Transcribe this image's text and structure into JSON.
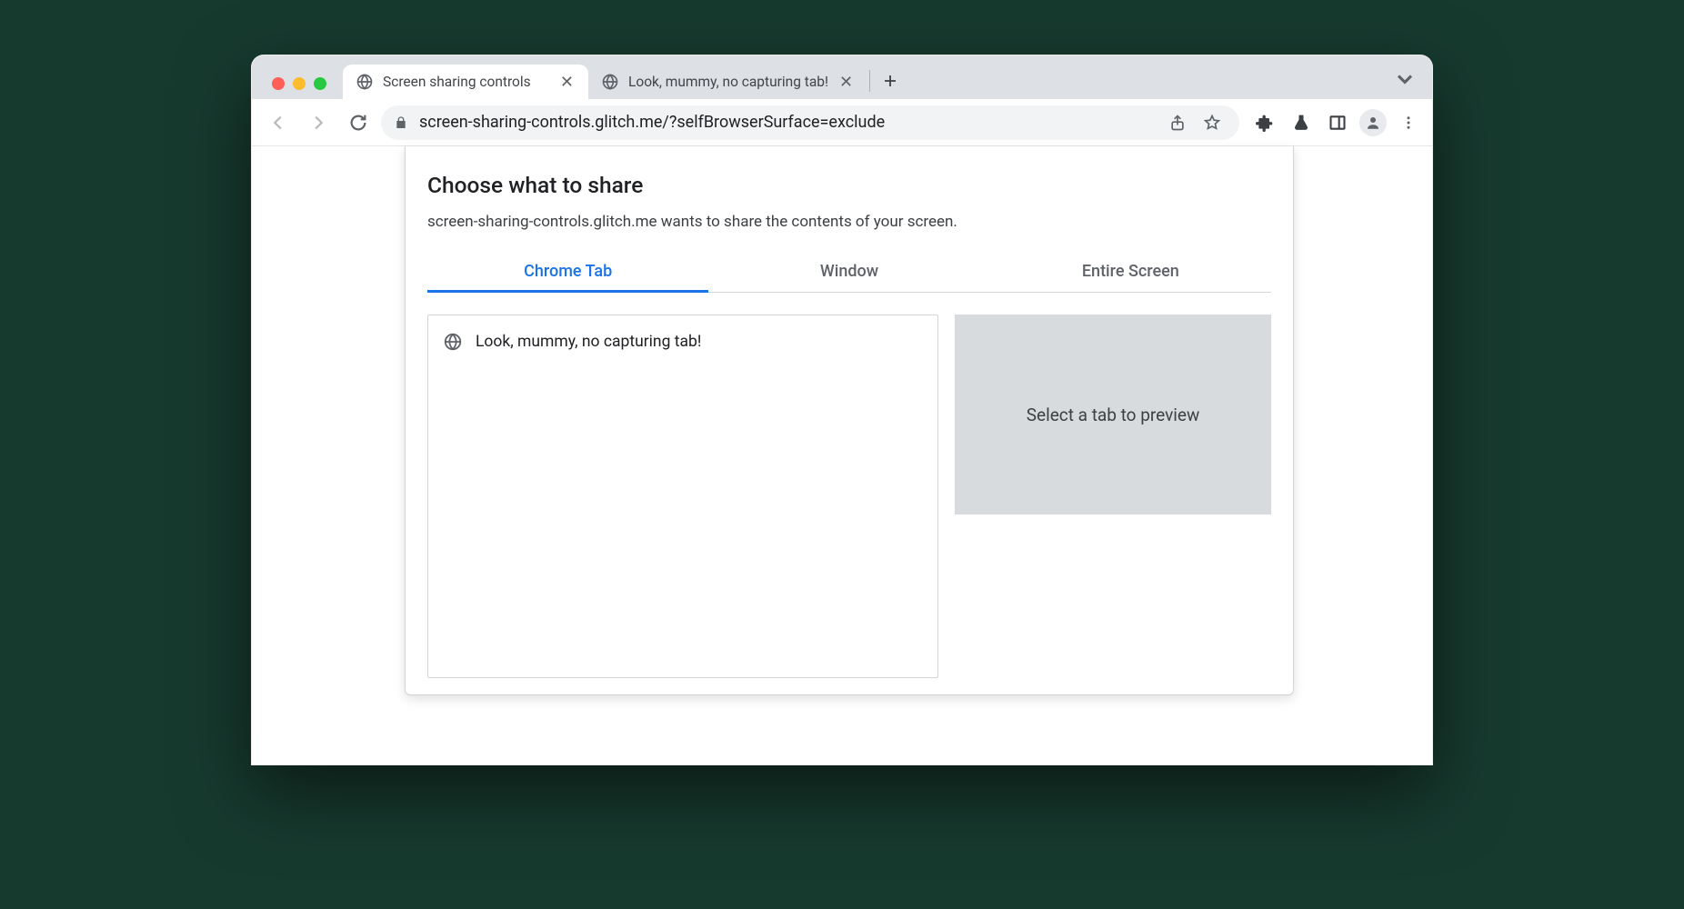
{
  "browser": {
    "tabs": [
      {
        "title": "Screen sharing controls",
        "active": true
      },
      {
        "title": "Look, mummy, no capturing tab!",
        "active": false
      }
    ],
    "url": "screen-sharing-controls.glitch.me/?selfBrowserSurface=exclude"
  },
  "dialog": {
    "title": "Choose what to share",
    "subtitle": "screen-sharing-controls.glitch.me wants to share the contents of your screen.",
    "surface_tabs": {
      "chrome_tab": "Chrome Tab",
      "window": "Window",
      "entire_screen": "Entire Screen"
    },
    "tab_list": [
      {
        "title": "Look, mummy, no capturing tab!"
      }
    ],
    "preview_placeholder": "Select a tab to preview"
  }
}
